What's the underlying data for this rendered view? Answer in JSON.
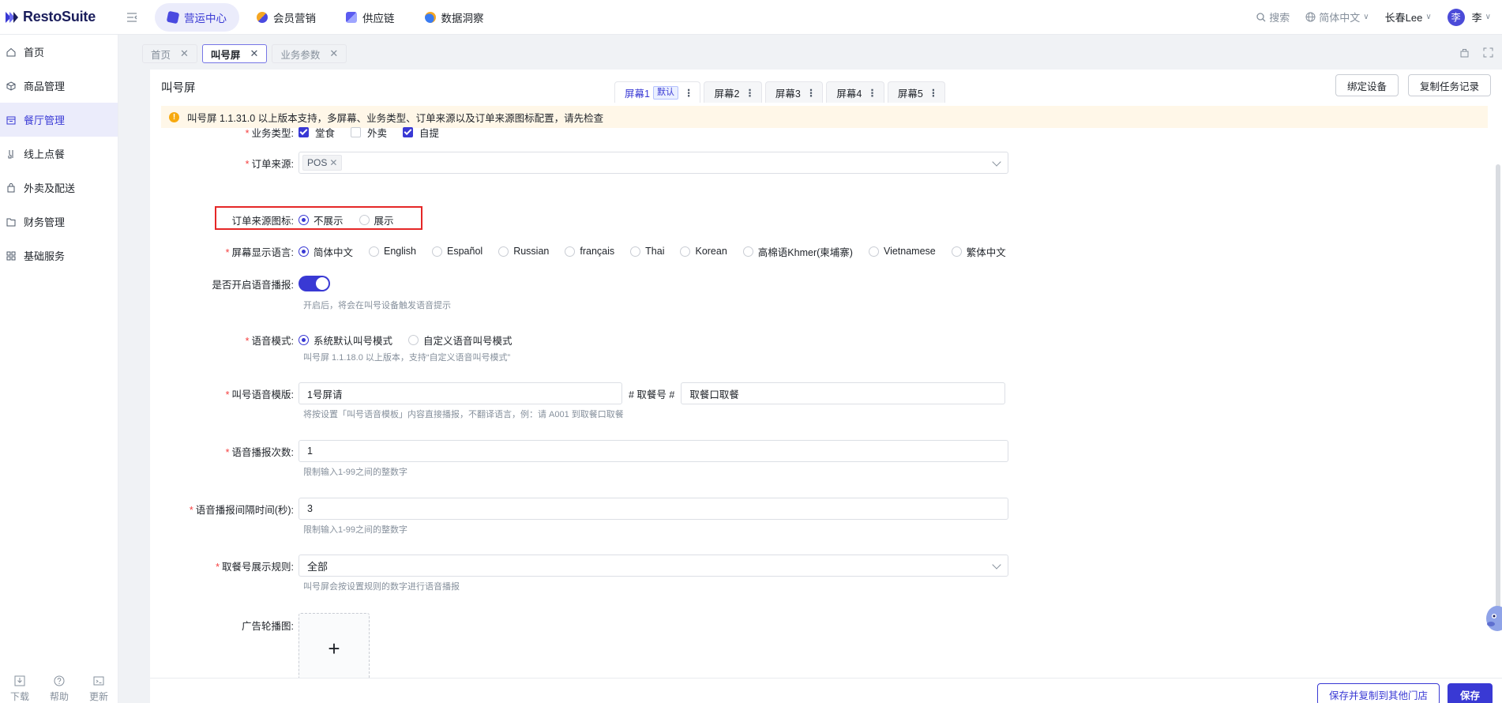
{
  "app": {
    "name": "RestoSuite"
  },
  "top_nav": [
    {
      "label": "营运中心",
      "icon": "ops-center-icon",
      "color": "#4a4ae0"
    },
    {
      "label": "会员营销",
      "icon": "member-marketing-icon",
      "color": "#f5a623"
    },
    {
      "label": "供应链",
      "icon": "supply-chain-icon",
      "color": "#5b5bf0"
    },
    {
      "label": "数据洞察",
      "icon": "data-insight-icon",
      "color": "#3a7bf0"
    }
  ],
  "top_right": {
    "search": "搜索",
    "language": "简体中文",
    "store": "长春Lee",
    "avatar_char": "李",
    "user": "李"
  },
  "sidebar": {
    "items": [
      {
        "label": "首页",
        "icon": "home-icon"
      },
      {
        "label": "商品管理",
        "icon": "product-icon"
      },
      {
        "label": "餐厅管理",
        "icon": "restaurant-icon"
      },
      {
        "label": "线上点餐",
        "icon": "online-order-icon"
      },
      {
        "label": "外卖及配送",
        "icon": "delivery-icon"
      },
      {
        "label": "财务管理",
        "icon": "finance-icon"
      },
      {
        "label": "基础服务",
        "icon": "basic-service-icon"
      }
    ],
    "bottom": {
      "download": "下载",
      "help": "帮助",
      "update": "更新"
    }
  },
  "tabs": [
    {
      "label": "首页"
    },
    {
      "label": "叫号屏"
    },
    {
      "label": "业务参数"
    }
  ],
  "page": {
    "title": "叫号屏",
    "screen_tabs": [
      {
        "label": "屏幕1",
        "badge": "默认"
      },
      {
        "label": "屏幕2"
      },
      {
        "label": "屏幕3"
      },
      {
        "label": "屏幕4"
      },
      {
        "label": "屏幕5"
      }
    ],
    "bind_device": "绑定设备",
    "copy_task_log": "复制任务记录",
    "notice": "叫号屏 1.1.31.0 以上版本支持，多屏幕、业务类型、订单来源以及订单来源图标配置，请先检查"
  },
  "form": {
    "business_type": {
      "label": "业务类型:",
      "options": [
        {
          "label": "堂食",
          "checked": true
        },
        {
          "label": "外卖",
          "checked": false
        },
        {
          "label": "自提",
          "checked": true
        }
      ]
    },
    "order_source": {
      "label": "订单来源:",
      "tag": "POS"
    },
    "order_source_icon": {
      "label": "订单来源图标:",
      "options": [
        {
          "label": "不展示",
          "checked": true
        },
        {
          "label": "展示",
          "checked": false
        }
      ]
    },
    "screen_language": {
      "label": "屏幕显示语言:",
      "options": [
        {
          "label": "简体中文",
          "checked": true
        },
        {
          "label": "English",
          "checked": false
        },
        {
          "label": "Español",
          "checked": false
        },
        {
          "label": "Russian",
          "checked": false
        },
        {
          "label": "français",
          "checked": false
        },
        {
          "label": "Thai",
          "checked": false
        },
        {
          "label": "Korean",
          "checked": false
        },
        {
          "label": "高棉语Khmer(柬埔寨)",
          "checked": false
        },
        {
          "label": "Vietnamese",
          "checked": false
        },
        {
          "label": "繁体中文",
          "checked": false
        }
      ]
    },
    "voice_broadcast": {
      "label": "是否开启语音播报:",
      "enabled": true,
      "hint": "开启后，将会在叫号设备触发语音提示"
    },
    "voice_mode": {
      "label": "语音模式:",
      "options": [
        {
          "label": "系统默认叫号模式",
          "checked": true
        },
        {
          "label": "自定义语音叫号模式",
          "checked": false
        }
      ],
      "hint": "叫号屏 1.1.18.0 以上版本，支持“自定义语音叫号模式”"
    },
    "voice_template": {
      "label": "叫号语音模版:",
      "value1": "1号屏请",
      "middle": "# 取餐号 #",
      "value2": "取餐口取餐",
      "hint": "将按设置「叫号语音模板」内容直接播报，不翻译语言，例：请 A001 到取餐口取餐"
    },
    "broadcast_times": {
      "label": "语音播报次数:",
      "value": "1",
      "hint": "限制输入1-99之间的整数字"
    },
    "broadcast_interval": {
      "label": "语音播报间隔时间(秒):",
      "value": "3",
      "hint": "限制输入1-99之间的整数字"
    },
    "pickup_rule": {
      "label": "取餐号展示规则:",
      "value": "全部",
      "hint": "叫号屏会按设置规则的数字进行语音播报"
    },
    "ad_carousel": {
      "label": "广告轮播图:",
      "upload_symbol": "+"
    }
  },
  "footer": {
    "save_copy": "保存并复制到其他门店",
    "save": "保存"
  },
  "colors": {
    "primary": "#3939d4",
    "warning": "#f7a90e",
    "highlight": "#e52727",
    "required": "#f53f3f"
  }
}
